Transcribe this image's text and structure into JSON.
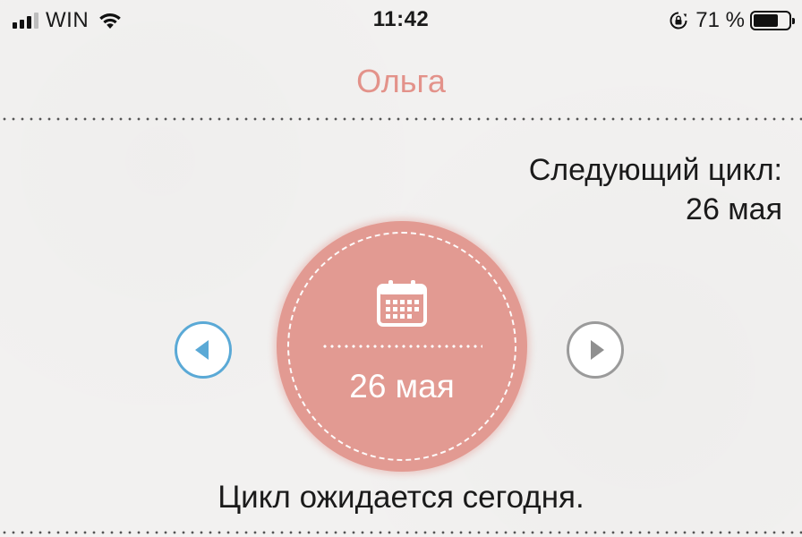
{
  "status_bar": {
    "carrier": "WIN",
    "time": "11:42",
    "battery_percent": "71 %",
    "battery_level": 0.71,
    "signal_bars_active": 3,
    "signal_bars_total": 4,
    "icons": [
      "signal-icon",
      "wifi-icon",
      "rotation-lock-icon",
      "battery-icon"
    ]
  },
  "header": {
    "title": "Ольга",
    "title_color": "#e3928a"
  },
  "next_cycle": {
    "label": "Следующий цикл:",
    "date": "26 мая"
  },
  "cycle_circle": {
    "icon": "calendar-icon",
    "date": "26 мая",
    "color": "#e29a92"
  },
  "navigation": {
    "prev_icon": "chevron-left-icon",
    "next_icon": "chevron-right-icon",
    "prev_color": "#5aa9d6",
    "next_color": "#9a9a9a"
  },
  "message": "Цикл ожидается сегодня."
}
